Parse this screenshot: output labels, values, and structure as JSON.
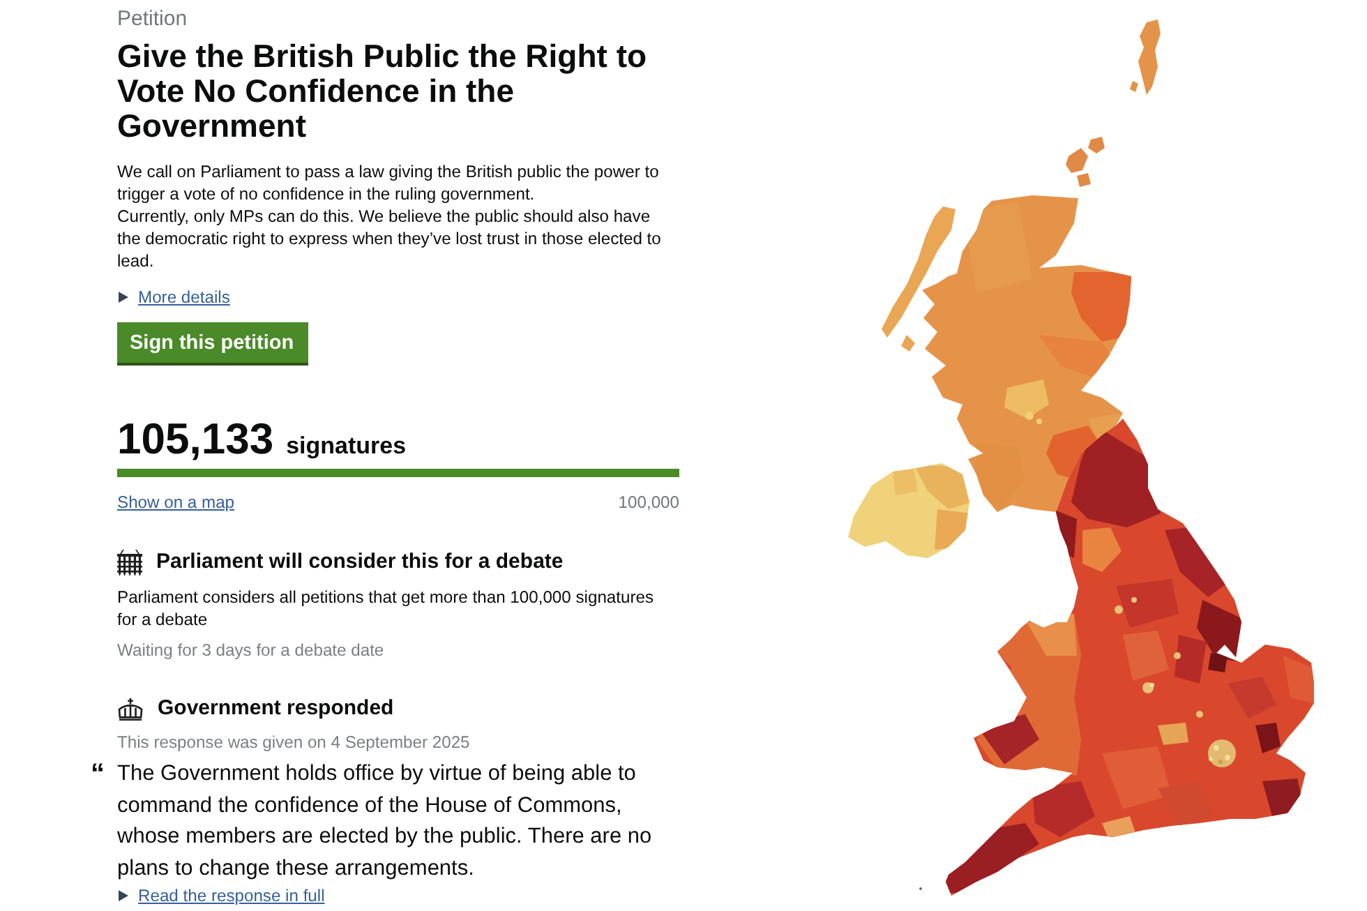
{
  "petition": {
    "label": "Petition",
    "title": "Give the British Public the Right to Vote No Confidence in the Government",
    "description": [
      "We call on Parliament to pass a law giving the British public the power to trigger a vote of no confidence in the ruling government.",
      "Currently, only MPs can do this. We believe the public should also have the democratic right to express when they’ve lost trust in those elected to lead."
    ],
    "more_details_link": "More details",
    "sign_button": "Sign this petition"
  },
  "signatures": {
    "count": "105,133",
    "unit": "signatures",
    "level": 1,
    "map_link": "Show on a map",
    "target": "100,000"
  },
  "debate": {
    "heading": "Parliament will consider this for a debate",
    "text": "Parliament considers all petitions that get more than 100,000 signatures for a debate",
    "status": "Waiting for 3 days for a debate date"
  },
  "response": {
    "heading": "Government responded",
    "date_text": "This response was given on 4 September 2025",
    "quote_mark": "“",
    "quote": "The Government holds office by virtue of being able to command the confidence of the House of Commons, whose members are elected by the public. There are no plans to change these arrangements.",
    "read_link": "Read the response in full"
  }
}
